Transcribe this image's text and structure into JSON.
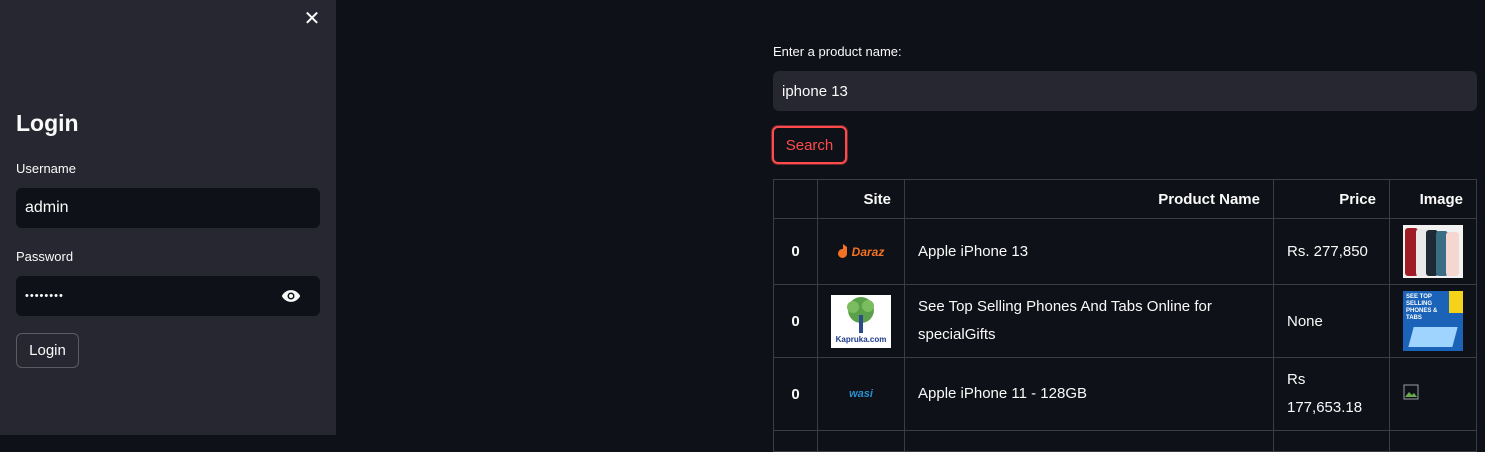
{
  "sidebar": {
    "title": "Login",
    "username_label": "Username",
    "username_value": "admin",
    "password_label": "Password",
    "password_value": "••••••••",
    "login_button": "Login"
  },
  "search": {
    "label": "Enter a product name:",
    "value": "iphone 13",
    "button": "Search"
  },
  "table": {
    "headers": [
      "",
      "Site",
      "Product Name",
      "Price",
      "Image"
    ],
    "rows": [
      {
        "index": "0",
        "site": "Daraz",
        "name": "Apple iPhone 13",
        "price": "Rs. 277,850"
      },
      {
        "index": "0",
        "site": "Kapruka.com",
        "name": "See Top Selling Phones And Tabs Online for specialGifts",
        "price": "None",
        "image_text": "SEE TOP SELLING PHONES & TABS"
      },
      {
        "index": "0",
        "site": "wasi",
        "name": "Apple iPhone 11 - 128GB",
        "price": "Rs 177,653.18"
      }
    ]
  },
  "colors": {
    "accent": "#ff4b4b",
    "background": "#0e1117",
    "sidebar": "#262730"
  }
}
